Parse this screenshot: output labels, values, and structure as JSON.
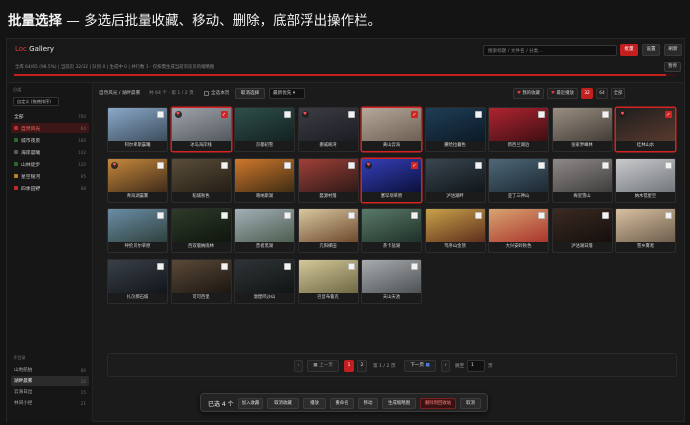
{
  "heading": {
    "bold": "批量选择",
    "rest": " — 多选后批量收藏、移动、删除，底部浮出操作栏。"
  },
  "app": {
    "logo_prefix": "Loc",
    "logo_rest": " Gallery",
    "stats": "全库 64/65 (98.5%) | 当前页 32/32 | 队列 0 | 生成中 0 | 并行数 1 · 仅按需生成当前浏览页的缩略图",
    "progress": 0.985,
    "search_placeholder": "搜索标题 / 文件名 / 分类...",
    "buttons": {
      "batch": "批量",
      "settings": "设置",
      "refresh": "刷新",
      "pause": "暂停"
    }
  },
  "sidebar": {
    "category_label": "分类",
    "sort_select": "自定义 (拖拽排序)",
    "items": [
      {
        "label": "全部",
        "count": "700",
        "dot": ""
      },
      {
        "label": "自然风光",
        "count": "64",
        "dot": "red",
        "active": true
      },
      {
        "label": "城市夜景",
        "count": "186",
        "dot": "green"
      },
      {
        "label": "海岸晨曦",
        "count": "142",
        "dot": "grey"
      },
      {
        "label": "山林徒步",
        "count": "120",
        "dot": "green"
      },
      {
        "label": "星空银河",
        "count": "95",
        "dot": "orange"
      },
      {
        "label": "四季田野",
        "count": "88",
        "dot": "red"
      }
    ],
    "bottom_label": "子目录",
    "bottom_items": [
      {
        "label": "山地航拍",
        "count": "86"
      },
      {
        "label": "湖畔晨雾",
        "count": "32",
        "active": true
      },
      {
        "label": "云海日出",
        "count": "15"
      },
      {
        "label": "林间小径",
        "count": "21"
      }
    ]
  },
  "toolbar": {
    "breadcrumb": "自然风光 / 湖畔晨雾",
    "total": "共 64 个 · 第 1 / 2 页",
    "select_page": "全选本页",
    "cancel_select": "取消选择",
    "sort": "最新优先",
    "fav": "我的收藏",
    "recent": "最近播放",
    "size_a": "32",
    "size_b": "64",
    "all": "全部"
  },
  "cards": [
    {
      "caption": "阿尔卑斯晨曦",
      "colors": [
        "#8aa9c9",
        "#3a4a5a"
      ],
      "heart": false,
      "selected": false
    },
    {
      "caption": "冰岛海岸线",
      "colors": [
        "#9ea4aa",
        "#50565c"
      ],
      "heart": true,
      "selected": true
    },
    {
      "caption": "京都初雪",
      "colors": [
        "#2e4f4a",
        "#12201e"
      ],
      "heart": false,
      "selected": false
    },
    {
      "caption": "挪威峡湾",
      "colors": [
        "#3c3c44",
        "#1b1b22"
      ],
      "heart": true,
      "selected": false
    },
    {
      "caption": "黄山云海",
      "colors": [
        "#b6a89a",
        "#6a5c50"
      ],
      "heart": false,
      "selected": true
    },
    {
      "caption": "撒哈拉暮色",
      "colors": [
        "#1f3e56",
        "#0b1824"
      ],
      "heart": false,
      "selected": false
    },
    {
      "caption": "新西兰湖泊",
      "colors": [
        "#b02430",
        "#3a0e12"
      ],
      "heart": false,
      "selected": false
    },
    {
      "caption": "张家界峰林",
      "colors": [
        "#9a8e82",
        "#403a34"
      ],
      "heart": false,
      "selected": false
    },
    {
      "caption": "桂林山水",
      "colors": [
        "#1e1e1e",
        "#5a3a2e"
      ],
      "heart": true,
      "selected": true
    },
    {
      "caption": "青海湖晨雾",
      "colors": [
        "#c7893c",
        "#3b2818"
      ],
      "heart": true,
      "selected": false
    },
    {
      "caption": "稻城秋色",
      "colors": [
        "#5a4e3a",
        "#231c14"
      ],
      "heart": false,
      "selected": false
    },
    {
      "caption": "喀纳斯湖",
      "colors": [
        "#d0782c",
        "#3a2a12"
      ],
      "heart": false,
      "selected": false
    },
    {
      "caption": "婺源村落",
      "colors": [
        "#a04038",
        "#2a1816"
      ],
      "heart": false,
      "selected": false
    },
    {
      "caption": "塞罕坝草原",
      "colors": [
        "#3440b8",
        "#0b0e38"
      ],
      "heart": true,
      "selected": true
    },
    {
      "caption": "泸沽湖畔",
      "colors": [
        "#3a4650",
        "#0e1418"
      ],
      "heart": false,
      "selected": false
    },
    {
      "caption": "亚丁三神山",
      "colors": [
        "#4e6878",
        "#1a2630"
      ],
      "heart": false,
      "selected": false
    },
    {
      "caption": "梅里雪山",
      "colors": [
        "#8e8a88",
        "#3c3a3a"
      ],
      "heart": false,
      "selected": false
    },
    {
      "caption": "纳木错星空",
      "colors": [
        "#c8cacc",
        "#707478"
      ],
      "heart": false,
      "selected": false
    },
    {
      "caption": "呼伦贝尔草原",
      "colors": [
        "#6a8ea6",
        "#2e3e3a"
      ],
      "heart": false,
      "selected": false
    },
    {
      "caption": "西双版纳雨林",
      "colors": [
        "#2e3a2a",
        "#0e140c"
      ],
      "heart": false,
      "selected": false
    },
    {
      "caption": "普者黑湖",
      "colors": [
        "#a2b0b8",
        "#4a5a4a"
      ],
      "heart": false,
      "selected": false
    },
    {
      "caption": "元阳梯田",
      "colors": [
        "#d8c8a0",
        "#6a4428"
      ],
      "heart": false,
      "selected": false
    },
    {
      "caption": "茶卡盐湖",
      "colors": [
        "#5a7a68",
        "#1c2e26"
      ],
      "heart": false,
      "selected": false
    },
    {
      "caption": "笃序山金顶",
      "colors": [
        "#c9a24a",
        "#5a2a1a"
      ],
      "heart": false,
      "selected": false
    },
    {
      "caption": "大兴安岭秋色",
      "colors": [
        "#d8a470",
        "#a8302a"
      ],
      "heart": false,
      "selected": false
    },
    {
      "caption": "泸沽湖日落",
      "colors": [
        "#3a2a22",
        "#140e0c"
      ],
      "heart": false,
      "selected": false
    },
    {
      "caption": "雪乡雾凇",
      "colors": [
        "#d8c0a0",
        "#6a5a4a"
      ],
      "heart": false,
      "selected": false
    },
    {
      "caption": "扎尕那石城",
      "colors": [
        "#3a4048",
        "#10141a"
      ],
      "heart": false,
      "selected": false
    },
    {
      "caption": "可可西里",
      "colors": [
        "#5a4a38",
        "#1a1410"
      ],
      "heart": false,
      "selected": false
    },
    {
      "caption": "敦煌鸣沙山",
      "colors": [
        "#2e3436",
        "#101314"
      ],
      "heart": false,
      "selected": false
    },
    {
      "caption": "巴音布鲁克",
      "colors": [
        "#d4c89a",
        "#6a6440"
      ],
      "heart": false,
      "selected": false
    },
    {
      "caption": "天山天池",
      "colors": [
        "#a8acae",
        "#4a4e50"
      ],
      "heart": false,
      "selected": false
    }
  ],
  "pager": {
    "prev": "上一页",
    "page1": "1",
    "page2": "2",
    "page_info": "第 1 / 2 页",
    "next": "下一页",
    "jump_label": "跳至",
    "jump_value": "1",
    "jump_unit": "页"
  },
  "floatbar": {
    "count": "已选 4 个",
    "buttons": [
      "加入收藏",
      "取消收藏",
      "播放",
      "重命名",
      "移动",
      "生成缩略图",
      "删除到回收站",
      "取消"
    ]
  }
}
